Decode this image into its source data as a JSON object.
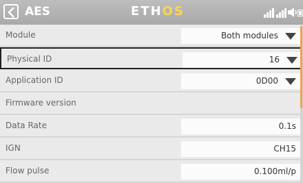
{
  "header": {
    "title": "AES",
    "logo_main": "ETH",
    "logo_accent": "OS"
  },
  "rows": [
    {
      "label": "Module",
      "value": "Both modules",
      "type": "select"
    },
    {
      "label": "Physical ID",
      "value": "16",
      "type": "select",
      "selected": true
    },
    {
      "label": "Application ID",
      "value": "0D00",
      "type": "select"
    },
    {
      "label": "Firmware version",
      "value": "",
      "type": "static"
    },
    {
      "label": "Data Rate",
      "value": "0.1s",
      "type": "input"
    },
    {
      "label": "IGN",
      "value": "CH15",
      "type": "input"
    },
    {
      "label": "Flow pulse",
      "value": "0.100ml/p",
      "type": "input"
    }
  ],
  "colors": {
    "accent": "#f0a24a",
    "header_bg": "#b3b3b3",
    "row_bg": "#eaeaea"
  },
  "icons": [
    "back-arrow-icon",
    "rssi-icon",
    "signal-bars-icon",
    "volume-icon",
    "battery-icon"
  ]
}
